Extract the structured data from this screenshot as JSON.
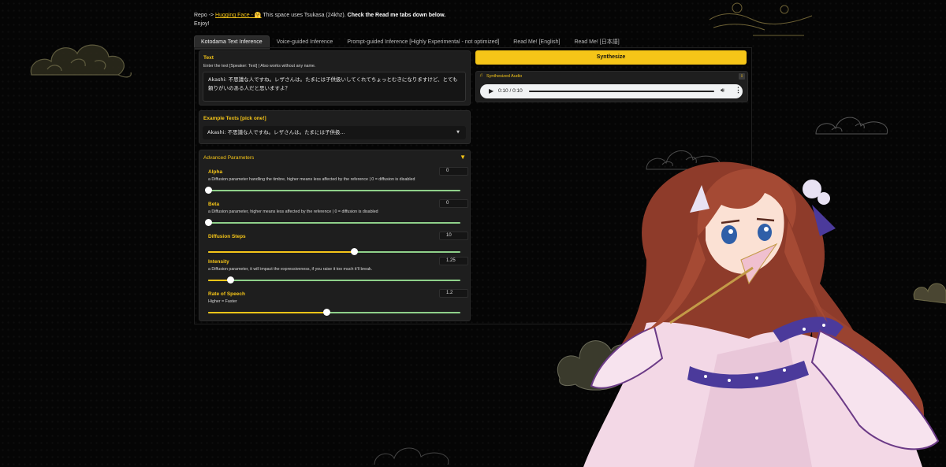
{
  "intro": {
    "repo_prefix": "Repo -> ",
    "repo_link": "Hugging Face - 🤗",
    "line1_rest": " This space uses Tsukasa (24khz). ",
    "line1_bold": "Check the Read me tabs down below.",
    "line2": "Enjoy!"
  },
  "tabs": [
    {
      "label": "Kotodama Text Inference",
      "active": true
    },
    {
      "label": "Voice-guided Inference",
      "active": false
    },
    {
      "label": "Prompt-guided Inference [Highly Experimental - not optimized]",
      "active": false
    },
    {
      "label": "Read Me! [English]",
      "active": false
    },
    {
      "label": "Read Me! [日本語]",
      "active": false
    }
  ],
  "text_input": {
    "label": "Text",
    "hint": "Enter the text [Speaker: Text] | Also works without any name.",
    "value": "Akashi: 不思議な人ですね。レザさんは。たまには子供扱いしてくれてちょっとむきになりますけど、とても頼りがいのある人だと思いますよ？"
  },
  "examples": {
    "label": "Example Texts [pick one!]",
    "selected": "Akashi: 不思議な人ですね。レザさんは。たまには子供扱..."
  },
  "advanced": {
    "title": "Advanced Parameters",
    "params": [
      {
        "name": "Alpha",
        "desc": "a Diffusion parameter handling the timbre, higher means less affected by the reference | 0 = diffusion is disabled",
        "value": "0",
        "fraction": 0.0
      },
      {
        "name": "Beta",
        "desc": "a Diffusion parameter, higher means less affected by the reference | 0 = diffusion is disabled",
        "value": "0",
        "fraction": 0.0
      },
      {
        "name": "Diffusion Steps",
        "desc": "",
        "value": "10",
        "fraction": 0.58
      },
      {
        "name": "Intensity",
        "desc": "a Diffusion parameter, it will impact the expressiveness, if you raise it too much it'll break.",
        "value": "1.25",
        "fraction": 0.09
      },
      {
        "name": "Rate of Speech",
        "desc": "Higher = Faster",
        "value": "1.2",
        "fraction": 0.47
      }
    ]
  },
  "synthesize_label": "Synthesize",
  "audio": {
    "label": "Synthesized Audio",
    "time": "0:10 / 0:10",
    "progress": 1.0
  },
  "colors": {
    "accent": "#f5c518",
    "slider_filled": "#f5c518",
    "slider_rest": "#8fd18a",
    "panel": "#1e1e1e"
  }
}
